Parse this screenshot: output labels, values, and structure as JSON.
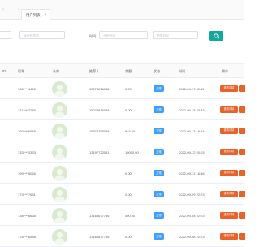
{
  "tabs": [
    {
      "label": "用户列表",
      "close": "×"
    }
  ],
  "filter": {
    "field1_value": "",
    "field2_placeholder": "请选择状态",
    "time_label": "时间",
    "start_placeholder": "开始时间",
    "end_placeholder": "结束时间"
  },
  "table": {
    "headers": [
      "ID",
      "昵称",
      "头像",
      "推荐人",
      "余额",
      "状态",
      "时间",
      "操作"
    ],
    "rows": [
      {
        "id": "3",
        "nickname": "186****4462",
        "referrer": "15078816088",
        "balance": "0.00",
        "status": "正常",
        "time": "2022-09-17 00:11",
        "action": "查看详情"
      },
      {
        "id": "1",
        "nickname": "131****7285",
        "referrer": "15078816088",
        "balance": "0.00",
        "status": "正常",
        "time": "2022-09-15 23:33",
        "action": "查看详情"
      },
      {
        "id": "0",
        "nickname": "150****6588",
        "referrer": "15977755088",
        "balance": "845.00",
        "status": "正常",
        "time": "2022-09-13 16:54",
        "action": "查看详情"
      },
      {
        "id": "3",
        "nickname": "133****3333",
        "referrer": "13197722091",
        "balance": "10000.00",
        "status": "正常",
        "time": "2022-09-12 20:03",
        "action": "查看详情"
      },
      {
        "id": "3",
        "nickname": "199****5066",
        "referrer": "",
        "balance": "0.00",
        "status": "正常",
        "time": "2022-09-12 16:46",
        "action": "查看详情"
      },
      {
        "id": "1",
        "nickname": "173****7631",
        "referrer": "",
        "balance": "0.00",
        "status": "正常",
        "time": "2022-09-09 22:23",
        "action": "查看详情"
      },
      {
        "id": "3",
        "nickname": "138****6668",
        "referrer": "13166677786",
        "balance": "400.00",
        "status": "正常",
        "time": "2022-09-08 22:23",
        "action": "查看详情"
      },
      {
        "id": "3",
        "nickname": "178****6588",
        "referrer": "13166677786",
        "balance": "0.00",
        "status": "正常",
        "time": "2022-09-08 22:23",
        "action": "查看详情"
      }
    ]
  },
  "colors": {
    "primary": "#13a89e",
    "status_blue": "#409eff",
    "action_orange": "#e8622c"
  }
}
